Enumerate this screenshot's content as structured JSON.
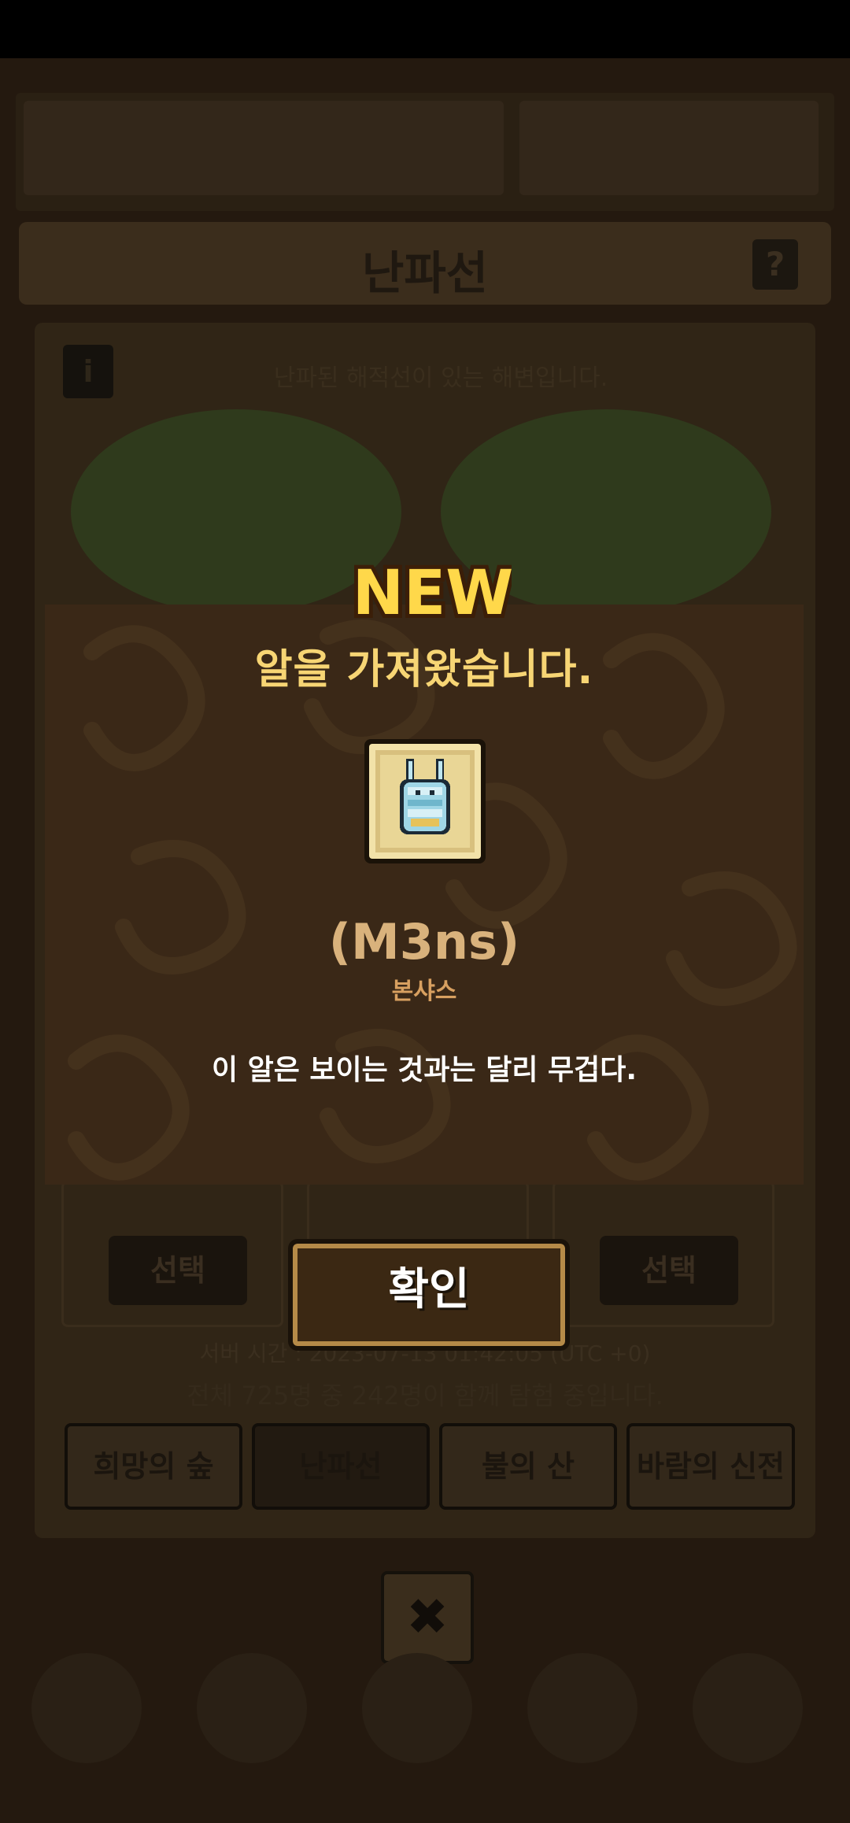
{
  "background": {
    "panel_title": "난파선",
    "help_label": "?",
    "info_label": "i",
    "description": "난파된 해적선이 있는 해변입니다.",
    "select_label": "선택",
    "server_time": "서버 시간 : 2023-07-13 01:42:05 (UTC +0)",
    "participants": "전체 725명 중 242명이 함께 탐험 중입니다.",
    "tabs": [
      "희망의 숲",
      "난파선",
      "불의 산",
      "바람의 신전"
    ],
    "close_icon": "✖"
  },
  "modal": {
    "badge": "NEW",
    "title": "알을 가져왔습니다.",
    "egg_name": "(M3ns)",
    "egg_subtitle": "본샤스",
    "egg_description": "이 알은 보이는 것과는 달리 무겁다.",
    "confirm_label": "확인"
  },
  "colors": {
    "modal_bg": "#3a2817",
    "title": "#f7d574",
    "egg_name": "#d9b27c",
    "egg_subtitle": "#d8a060"
  }
}
